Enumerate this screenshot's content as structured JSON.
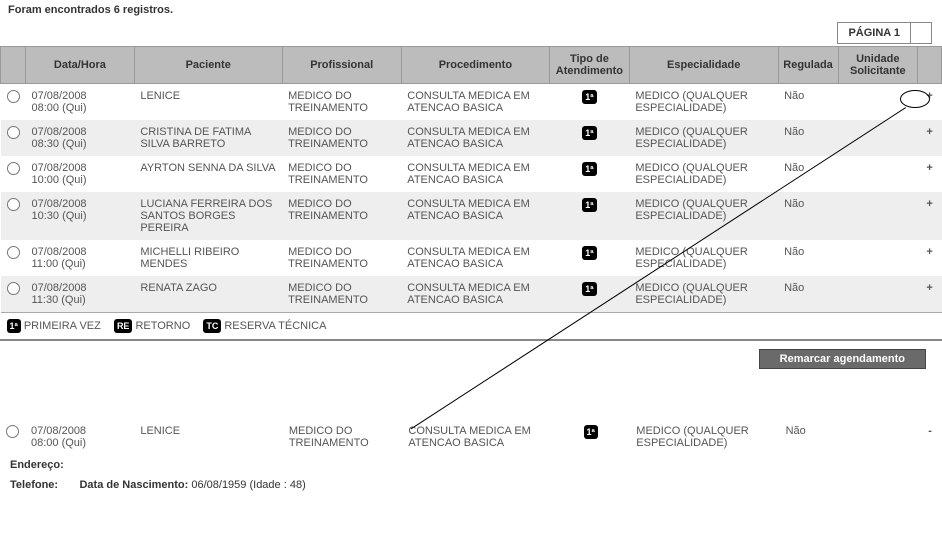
{
  "resultsText": "Foram encontrados 6 registros.",
  "pageLabel": "PÁGINA 1",
  "columns": {
    "datahora": "Data/Hora",
    "paciente": "Paciente",
    "profissional": "Profissional",
    "procedimento": "Procedimento",
    "tipo": "Tipo de Atendimento",
    "especialidade": "Especialidade",
    "regulada": "Regulada",
    "unidade": "Unidade Solicitante"
  },
  "rows": [
    {
      "data": "07/08/2008",
      "hora": "08:00 (Qui)",
      "paciente": "LENICE",
      "prof": "MEDICO DO TREINAMENTO",
      "proc": "CONSULTA MEDICA EM ATENCAO BASICA",
      "tipo": "1ª",
      "espec": "MEDICO (QUALQUER ESPECIALIDADE)",
      "reg": "Não",
      "expand": "+"
    },
    {
      "data": "07/08/2008",
      "hora": "08:30 (Qui)",
      "paciente": "CRISTINA DE FATIMA SILVA BARRETO",
      "prof": "MEDICO DO TREINAMENTO",
      "proc": "CONSULTA MEDICA EM ATENCAO BASICA",
      "tipo": "1ª",
      "espec": "MEDICO (QUALQUER ESPECIALIDADE)",
      "reg": "Não",
      "expand": "+"
    },
    {
      "data": "07/08/2008",
      "hora": "10:00 (Qui)",
      "paciente": "AYRTON SENNA DA SILVA",
      "prof": "MEDICO DO TREINAMENTO",
      "proc": "CONSULTA MEDICA EM ATENCAO BASICA",
      "tipo": "1ª",
      "espec": "MEDICO (QUALQUER ESPECIALIDADE)",
      "reg": "Não",
      "expand": "+"
    },
    {
      "data": "07/08/2008",
      "hora": "10:30 (Qui)",
      "paciente": "LUCIANA FERREIRA DOS SANTOS BORGES PEREIRA",
      "prof": "MEDICO DO TREINAMENTO",
      "proc": "CONSULTA MEDICA EM ATENCAO BASICA",
      "tipo": "1ª",
      "espec": "MEDICO (QUALQUER ESPECIALIDADE)",
      "reg": "Não",
      "expand": "+"
    },
    {
      "data": "07/08/2008",
      "hora": "11:00 (Qui)",
      "paciente": "MICHELLI RIBEIRO MENDES",
      "prof": "MEDICO DO TREINAMENTO",
      "proc": "CONSULTA MEDICA EM ATENCAO BASICA",
      "tipo": "1ª",
      "espec": "MEDICO (QUALQUER ESPECIALIDADE)",
      "reg": "Não",
      "expand": "+"
    },
    {
      "data": "07/08/2008",
      "hora": "11:30 (Qui)",
      "paciente": "RENATA ZAGO",
      "prof": "MEDICO DO TREINAMENTO",
      "proc": "CONSULTA MEDICA EM ATENCAO BASICA",
      "tipo": "1ª",
      "espec": "MEDICO (QUALQUER ESPECIALIDADE)",
      "reg": "Não",
      "expand": "+"
    }
  ],
  "legend": {
    "primeira": {
      "badge": "1ª",
      "label": "PRIMEIRA VEZ"
    },
    "retorno": {
      "badge": "RE",
      "label": "RETORNO"
    },
    "reserva": {
      "badge": "TC",
      "label": "RESERVA TÉCNICA"
    }
  },
  "remarcarLabel": "Remarcar agendamento",
  "detail": {
    "row": {
      "data": "07/08/2008",
      "hora": "08:00 (Qui)",
      "paciente": "LENICE",
      "prof": "MEDICO DO TREINAMENTO",
      "proc": "CONSULTA MEDICA EM ATENCAO BASICA",
      "tipo": "1ª",
      "espec": "MEDICO (QUALQUER ESPECIALIDADE)",
      "reg": "Não",
      "expand": "-"
    },
    "enderecoLabel": "Endereço:",
    "telefoneLabel": "Telefone:",
    "nascLabel": "Data de Nascimento:",
    "nascValue": "06/08/1959 (Idade : 48)"
  }
}
